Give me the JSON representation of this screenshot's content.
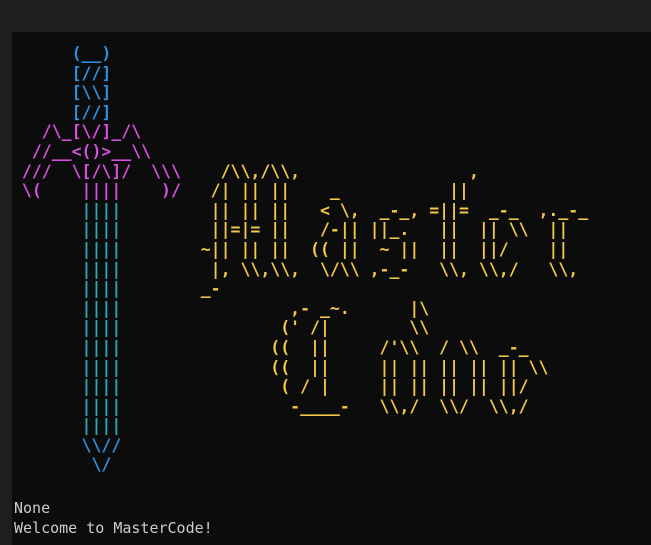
{
  "terminal": {
    "sword_lines": [
      {
        "color": "blue",
        "text": "      (__)"
      },
      {
        "color": "blue",
        "text": "      [//]"
      },
      {
        "color": "blue",
        "text": "      [\\\\]"
      },
      {
        "color": "blue",
        "text": "      [//]"
      },
      {
        "color": "pink",
        "text": "   /\\_[\\/]_/\\"
      },
      {
        "color": "pink",
        "text": "  //__<()>__\\\\"
      },
      {
        "color": "pink",
        "text": " ///  \\[/\\]/  \\\\\\"
      },
      {
        "color": "pink",
        "text": " \\(    ||||    )/"
      },
      {
        "color": "teal",
        "text": "       ||||"
      },
      {
        "color": "teal",
        "text": "       ||||"
      },
      {
        "color": "teal",
        "text": "       ||||"
      },
      {
        "color": "teal",
        "text": "       ||||"
      },
      {
        "color": "teal",
        "text": "       ||||"
      },
      {
        "color": "teal",
        "text": "       ||||"
      },
      {
        "color": "teal",
        "text": "       ||||"
      },
      {
        "color": "teal",
        "text": "       ||||"
      },
      {
        "color": "teal",
        "text": "       ||||"
      },
      {
        "color": "teal",
        "text": "       ||||"
      },
      {
        "color": "teal",
        "text": "       ||||"
      },
      {
        "color": "teal",
        "text": "       ||||"
      },
      {
        "color": "blue",
        "text": "       \\\\//"
      },
      {
        "color": "blue",
        "text": "        \\/"
      }
    ],
    "title_lines": [
      "",
      "",
      "",
      "",
      "",
      "",
      "                     /\\\\,/\\\\,                 ,",
      "                    /| || ||    _           ||",
      "                    || || ||   < \\,  _-_, =||=  _-_  ,._-_",
      "                    ||=|= ||   /-|| ||_.   ||  || \\\\  ||",
      "                   ~|| || ||  (( ||  ~ ||  ||  ||/    ||",
      "                    |, \\\\,\\\\,  \\/\\\\ ,-_-   \\\\, \\\\,/   \\\\,",
      "                   _-",
      "                            ,- _~.      |\\",
      "                           (' /|        \\\\",
      "                          ((  ||     /'\\\\  / \\\\  _-_",
      "                          ((  ||     || || || || || \\\\",
      "                           ( / |     || || || || ||/",
      "                            -____-   \\\\,/  \\\\/  \\\\,/"
    ],
    "output_none": "None",
    "output_welcome": "Welcome to MasterCode!"
  },
  "colors": {
    "blue": "#2f8fdd",
    "pink": "#d74ee0",
    "teal": "#2aa8b5",
    "yellow": "#f3c84a",
    "output_text": "#cccccc",
    "background": "#0c0c0c"
  }
}
